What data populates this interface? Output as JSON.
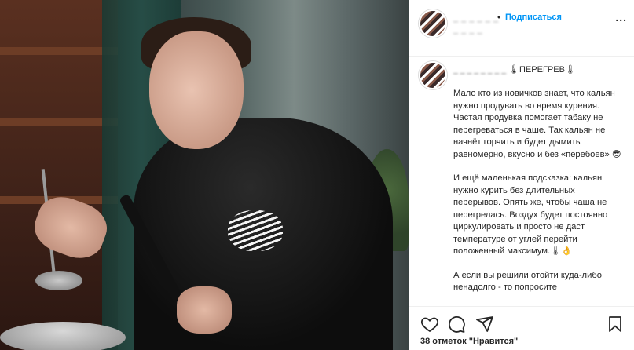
{
  "post": {
    "header": {
      "username": "_ _ _ _ _ _",
      "username_line2": "_ _ _ _",
      "dot": "•",
      "follow_label": "Подписаться",
      "more_label": "..."
    },
    "caption": {
      "username": "_ _ _ _ _ _ _ _",
      "title": "🌡ПЕРЕГРЕВ🌡",
      "paragraphs": [
        "Мало кто из новичков знает, что кальян нужно продувать во время курения. Частая продувка помогает табаку не перегреваться в чаше. Так кальян не начнёт горчить и будет дымить равномерно, вкусно и без «перебоев» 😎",
        "И ещё маленькая подсказка: кальян нужно курить без длительных перерывов. Опять же, чтобы чаша не перегрелась. Воздух будет постоянно циркулировать и просто не даст температуре от углей перейти положенный максимум.🌡👌",
        "А если вы решили отойти куда-либо ненадолго - то попросите"
      ]
    },
    "actions": {
      "likes_text": "38 отметок \"Нравится\""
    }
  }
}
